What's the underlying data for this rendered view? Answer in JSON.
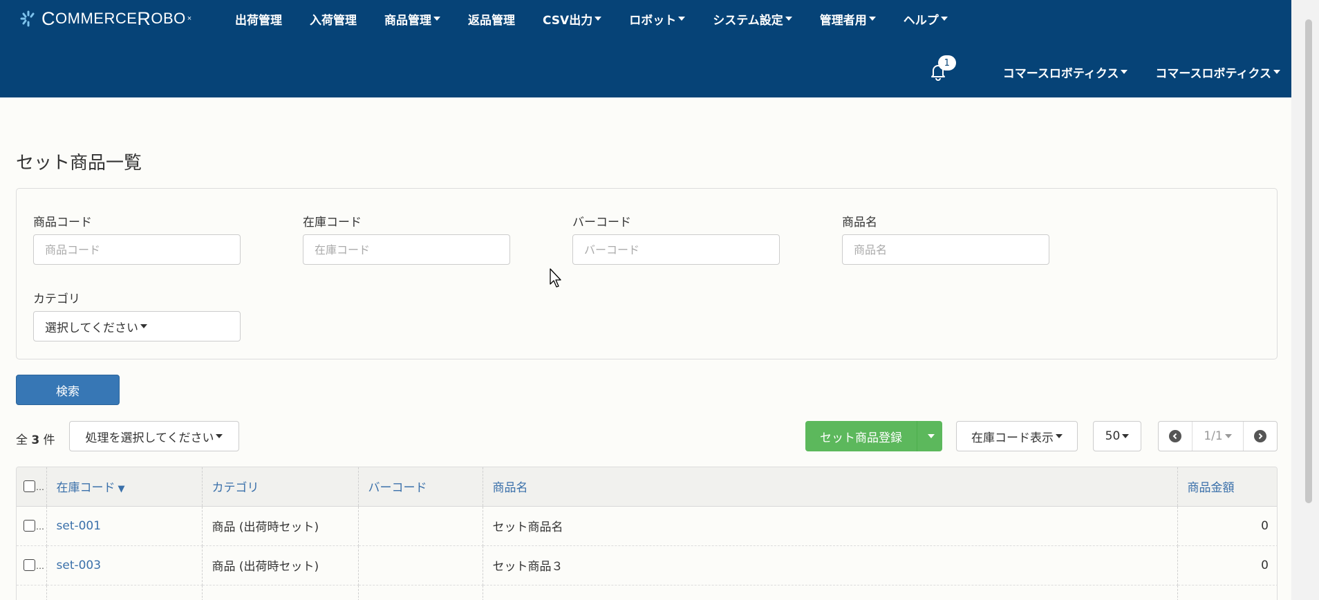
{
  "nav": {
    "brand": {
      "prefix": "C",
      "rest1": "OMMERCE ",
      "r": "R",
      "rest2": "OBO",
      "sup": "×"
    },
    "menu": [
      {
        "label": "出荷管理",
        "dropdown": false
      },
      {
        "label": "入荷管理",
        "dropdown": false
      },
      {
        "label": "商品管理",
        "dropdown": true
      },
      {
        "label": "返品管理",
        "dropdown": false
      },
      {
        "label": "CSV出力",
        "dropdown": true
      },
      {
        "label": "ロボット",
        "dropdown": true
      },
      {
        "label": "システム設定",
        "dropdown": true
      },
      {
        "label": "管理者用",
        "dropdown": true
      },
      {
        "label": "ヘルプ",
        "dropdown": true
      }
    ],
    "notification_count": "1",
    "user_menus": [
      "コマースロボティクス",
      "コマースロボティクス"
    ],
    "color": "#064377"
  },
  "page": {
    "title": "セット商品一覧"
  },
  "search": {
    "product_code": {
      "label": "商品コード",
      "placeholder": "商品コード"
    },
    "stock_code": {
      "label": "在庫コード",
      "placeholder": "在庫コード"
    },
    "barcode": {
      "label": "バーコード",
      "placeholder": "バーコード"
    },
    "product_name": {
      "label": "商品名",
      "placeholder": "商品名"
    },
    "category": {
      "label": "カテゴリ",
      "selected": "選択してください"
    },
    "search_button": "検索"
  },
  "toolbar": {
    "count_prefix": "全",
    "count": "3",
    "count_suffix": "件",
    "action_select": "処理を選択してください",
    "register_button": "セット商品登録",
    "display_mode": "在庫コード表示",
    "per_page": "50",
    "page": "1/1"
  },
  "table": {
    "columns": [
      "在庫コード",
      "カテゴリ",
      "バーコード",
      "商品名",
      "商品金額"
    ],
    "sort_indicator": "▼",
    "rows": [
      {
        "stock_code": "set-001",
        "category": "商品 (出荷時セット)",
        "barcode": "",
        "name": "セット商品名",
        "price": "0"
      },
      {
        "stock_code": "set-003",
        "category": "商品 (出荷時セット)",
        "barcode": "",
        "name": "セット商品３",
        "price": "0"
      }
    ]
  }
}
